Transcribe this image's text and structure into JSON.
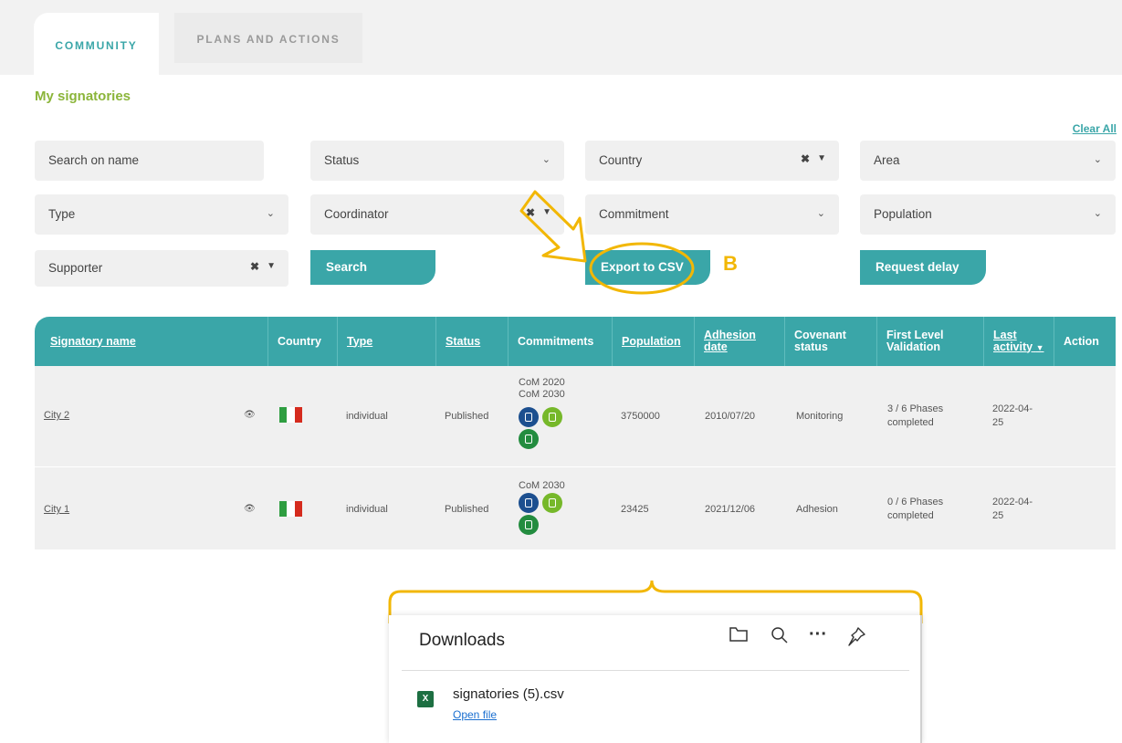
{
  "tabs": [
    {
      "label": "COMMUNITY",
      "active": true
    },
    {
      "label": "PLANS AND ACTIONS",
      "active": false
    }
  ],
  "section_title": "My signatories",
  "clear_all": "Clear All",
  "filters": {
    "search_placeholder": "Search on name",
    "status": "Status",
    "country": "Country",
    "area": "Area",
    "type": "Type",
    "coordinator": "Coordinator",
    "commitment": "Commitment",
    "population": "Population",
    "supporter": "Supporter"
  },
  "buttons": {
    "search": "Search",
    "export": "Export to CSV",
    "request_delay": "Request delay"
  },
  "annotation_label": "B",
  "table": {
    "headers": {
      "name": "Signatory name",
      "country": "Country",
      "type": "Type",
      "status": "Status",
      "commitments": "Commitments",
      "population": "Population",
      "adhesion_l1": "Adhesion",
      "adhesion_l2": "date",
      "covenant_l1": "Covenant",
      "covenant_l2": "status",
      "flv_l1": "First Level",
      "flv_l2": "Validation",
      "last_l1": "Last",
      "last_l2": "activity",
      "action": "Action"
    },
    "rows": [
      {
        "name": "City 2",
        "type": "individual",
        "status": "Published",
        "commitments": [
          "CoM 2020",
          "CoM 2030"
        ],
        "population": "3750000",
        "adhesion": "2010/07/20",
        "covenant": "Monitoring",
        "flv_l1": "3 / 6 Phases",
        "flv_l2": "completed",
        "last_l1": "2022-04-",
        "last_l2": "25"
      },
      {
        "name": "City 1",
        "type": "individual",
        "status": "Published",
        "commitments": [
          "CoM 2030"
        ],
        "population": "23425",
        "adhesion": "2021/12/06",
        "covenant": "Adhesion",
        "flv_l1": "0 / 6 Phases",
        "flv_l2": "completed",
        "last_l1": "2022-04-",
        "last_l2": "25"
      }
    ]
  },
  "downloads": {
    "title": "Downloads",
    "file_name": "signatories (5).csv",
    "open_file": "Open file"
  },
  "colors": {
    "teal": "#3aa6a8",
    "green_title": "#8bb53a",
    "annotation": "#f2b705"
  }
}
